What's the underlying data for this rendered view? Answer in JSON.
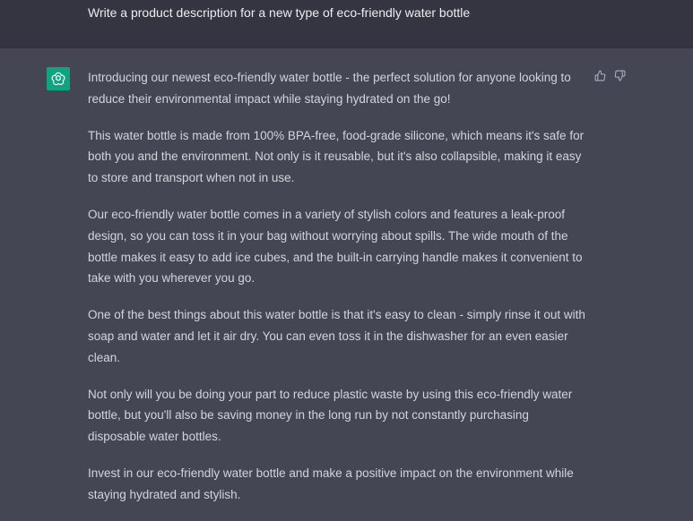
{
  "user_message": "Write a product description for a new type of eco-friendly water bottle",
  "assistant": {
    "paragraphs": [
      "Introducing our newest eco-friendly water bottle - the perfect solution for anyone looking to reduce their environmental impact while staying hydrated on the go!",
      "This water bottle is made from 100% BPA-free, food-grade silicone, which means it's safe for both you and the environment. Not only is it reusable, but it's also collapsible, making it easy to store and transport when not in use.",
      "Our eco-friendly water bottle comes in a variety of stylish colors and features a leak-proof design, so you can toss it in your bag without worrying about spills. The wide mouth of the bottle makes it easy to add ice cubes, and the built-in carrying handle makes it convenient to take with you wherever you go.",
      "One of the best things about this water bottle is that it's easy to clean - simply rinse it out with soap and water and let it air dry. You can even toss it in the dishwasher for an even easier clean.",
      "Not only will you be doing your part to reduce plastic waste by using this eco-friendly water bottle, but you'll also be saving money in the long run by not constantly purchasing disposable water bottles.",
      "Invest in our eco-friendly water bottle and make a positive impact on the environment while staying hydrated and stylish."
    ]
  },
  "icons": {
    "avatar": "openai-logo-icon",
    "like": "thumbs-up-icon",
    "dislike": "thumbs-down-icon"
  },
  "colors": {
    "user_bg": "#343541",
    "assistant_bg": "#444654",
    "avatar_bg": "#10a37f",
    "text": "#d1d5db"
  }
}
